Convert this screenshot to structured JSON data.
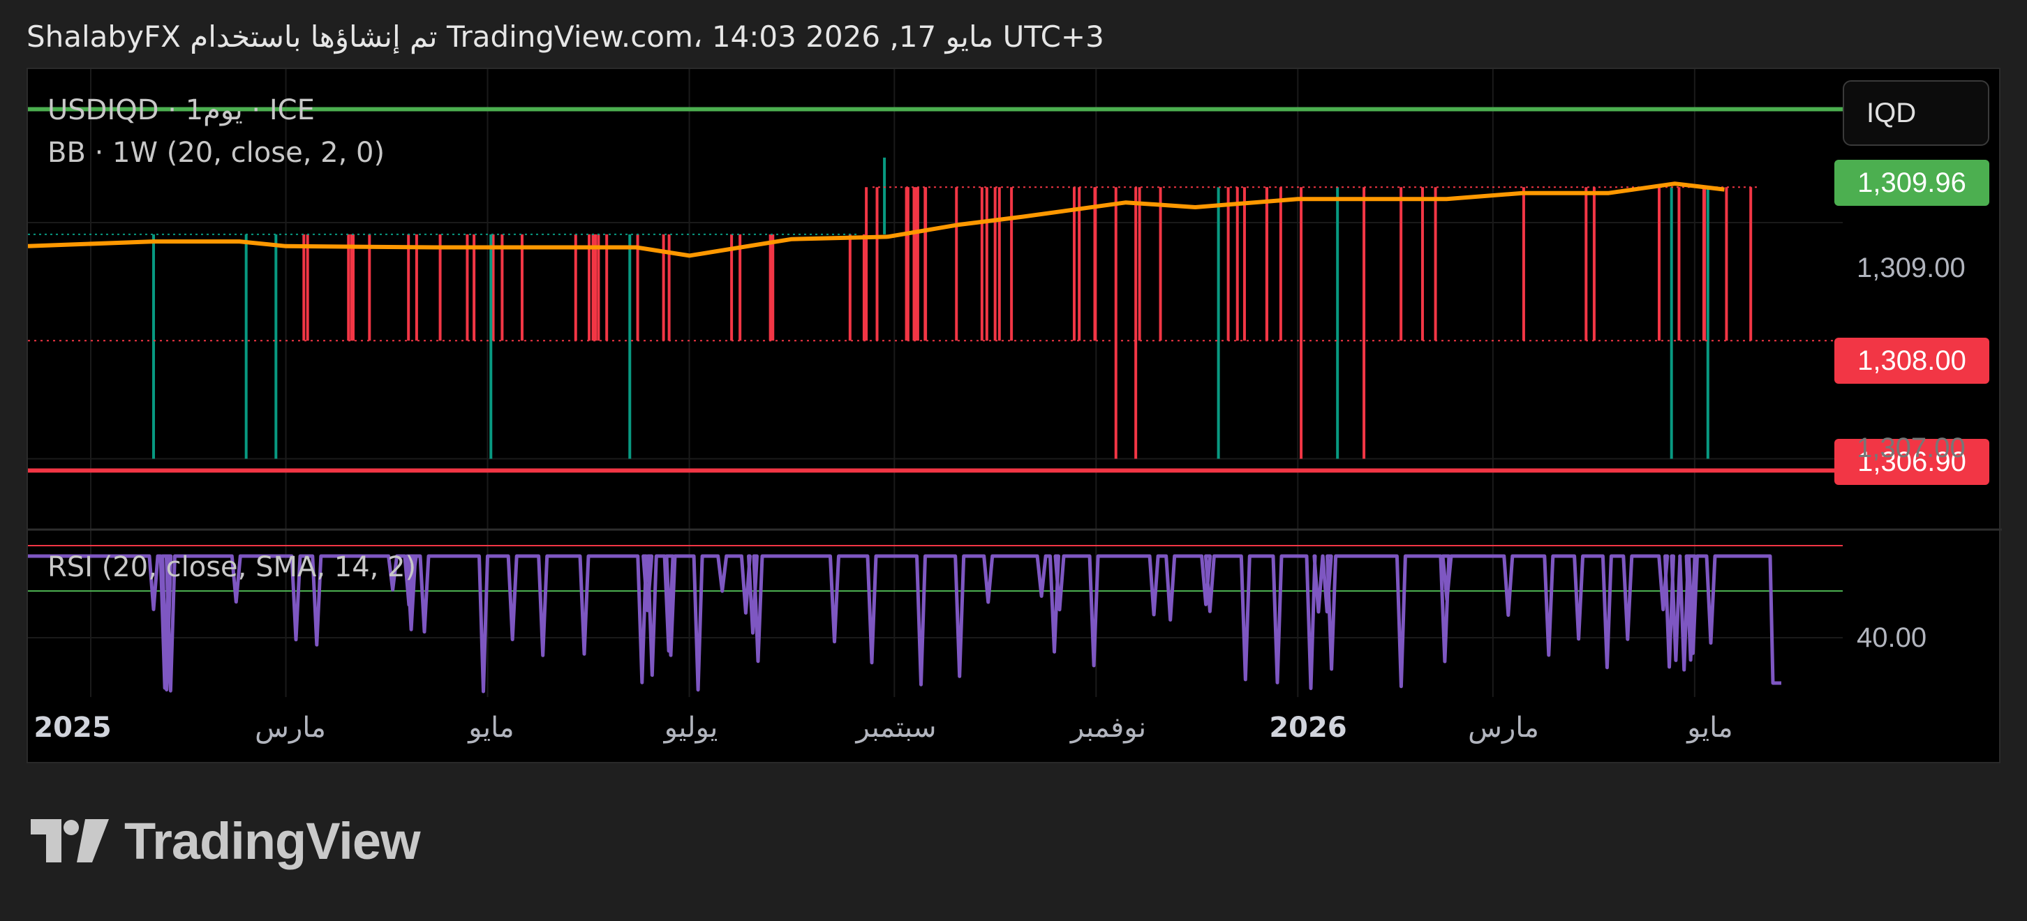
{
  "header": {
    "caption": "ShalabyFX تم إنشاؤها باستخدام TradingView.com، 14:03 2026 ,17 مايو UTC+3"
  },
  "legend": {
    "symbol_line": "USDIQD · 1يوم · ICE",
    "bb_line": "BB · 1W (20, close, 2, 0)",
    "rsi_line": "RSI (20, close, SMA, 14, 2)"
  },
  "currency_button": "IQD",
  "price_tags": {
    "upper_band": "1,309.96",
    "last_price": "1,308.00",
    "lower_band": "1,306.90"
  },
  "price_axis": {
    "label_1309": "1,309.00",
    "label_1307": "1,307.00",
    "rsi_label": "40.00"
  },
  "x_axis": [
    {
      "label": "2025",
      "year": true
    },
    {
      "label": "مارس",
      "year": false
    },
    {
      "label": "مايو",
      "year": false
    },
    {
      "label": "يوليو",
      "year": false
    },
    {
      "label": "سبتمبر",
      "year": false
    },
    {
      "label": "نوفمبر",
      "year": false
    },
    {
      "label": "2026",
      "year": true
    },
    {
      "label": "مارس",
      "year": false
    },
    {
      "label": "مايو",
      "year": false
    }
  ],
  "brand": {
    "name": "TradingView"
  },
  "colors": {
    "upper_band": "#4caf50",
    "lower_band": "#f23645",
    "basis": "#ff9800",
    "candle_up": "#089981",
    "candle_down": "#f23645",
    "rsi": "#7e57c2"
  },
  "chart_data": {
    "type": "candlestick",
    "symbol": "USDIQD",
    "timeframe": "1D",
    "price_range": [
      1306.4,
      1310.3
    ],
    "upper_band": 1309.96,
    "lower_band": 1306.9,
    "last_price": 1308.0,
    "price_ticks": [
      1309.0,
      1307.0
    ],
    "basis": [
      [
        "2025-01-01",
        1308.8
      ],
      [
        "2025-01-20",
        1308.84
      ],
      [
        "2025-02-15",
        1308.84
      ],
      [
        "2025-03-01",
        1308.8
      ],
      [
        "2025-04-15",
        1308.79
      ],
      [
        "2025-06-15",
        1308.79
      ],
      [
        "2025-07-01",
        1308.72
      ],
      [
        "2025-08-01",
        1308.86
      ],
      [
        "2025-08-30",
        1308.88
      ],
      [
        "2025-09-20",
        1308.98
      ],
      [
        "2025-10-10",
        1309.05
      ],
      [
        "2025-11-10",
        1309.17
      ],
      [
        "2025-12-01",
        1309.13
      ],
      [
        "2026-01-01",
        1309.2
      ],
      [
        "2026-02-15",
        1309.2
      ],
      [
        "2026-03-10",
        1309.25
      ],
      [
        "2026-04-05",
        1309.25
      ],
      [
        "2026-04-25",
        1309.33
      ],
      [
        "2026-05-10",
        1309.28
      ]
    ],
    "spike_bars": [
      {
        "date": "2025-01-20",
        "low": 1307.0,
        "color": "up"
      },
      {
        "date": "2025-02-17",
        "low": 1307.0,
        "color": "up"
      },
      {
        "date": "2025-02-26",
        "low": 1307.0,
        "color": "up"
      },
      {
        "date": "2025-05-02",
        "low": 1307.0,
        "color": "up"
      },
      {
        "date": "2025-06-13",
        "low": 1307.0,
        "color": "up"
      },
      {
        "date": "2025-11-07",
        "low": 1307.0,
        "color": "down"
      },
      {
        "date": "2025-11-13",
        "low": 1307.0,
        "color": "down"
      },
      {
        "date": "2025-12-08",
        "low": 1307.0,
        "color": "up"
      },
      {
        "date": "2026-01-02",
        "low": 1307.0,
        "color": "down"
      },
      {
        "date": "2026-01-13",
        "low": 1307.0,
        "color": "up"
      },
      {
        "date": "2026-01-21",
        "low": 1307.0,
        "color": "down"
      },
      {
        "date": "2026-04-24",
        "low": 1307.0,
        "color": "up"
      },
      {
        "date": "2026-05-05",
        "low": 1307.0,
        "color": "up"
      }
    ],
    "rsi": {
      "levels": [
        70,
        60,
        40
      ],
      "last": 31
    }
  }
}
